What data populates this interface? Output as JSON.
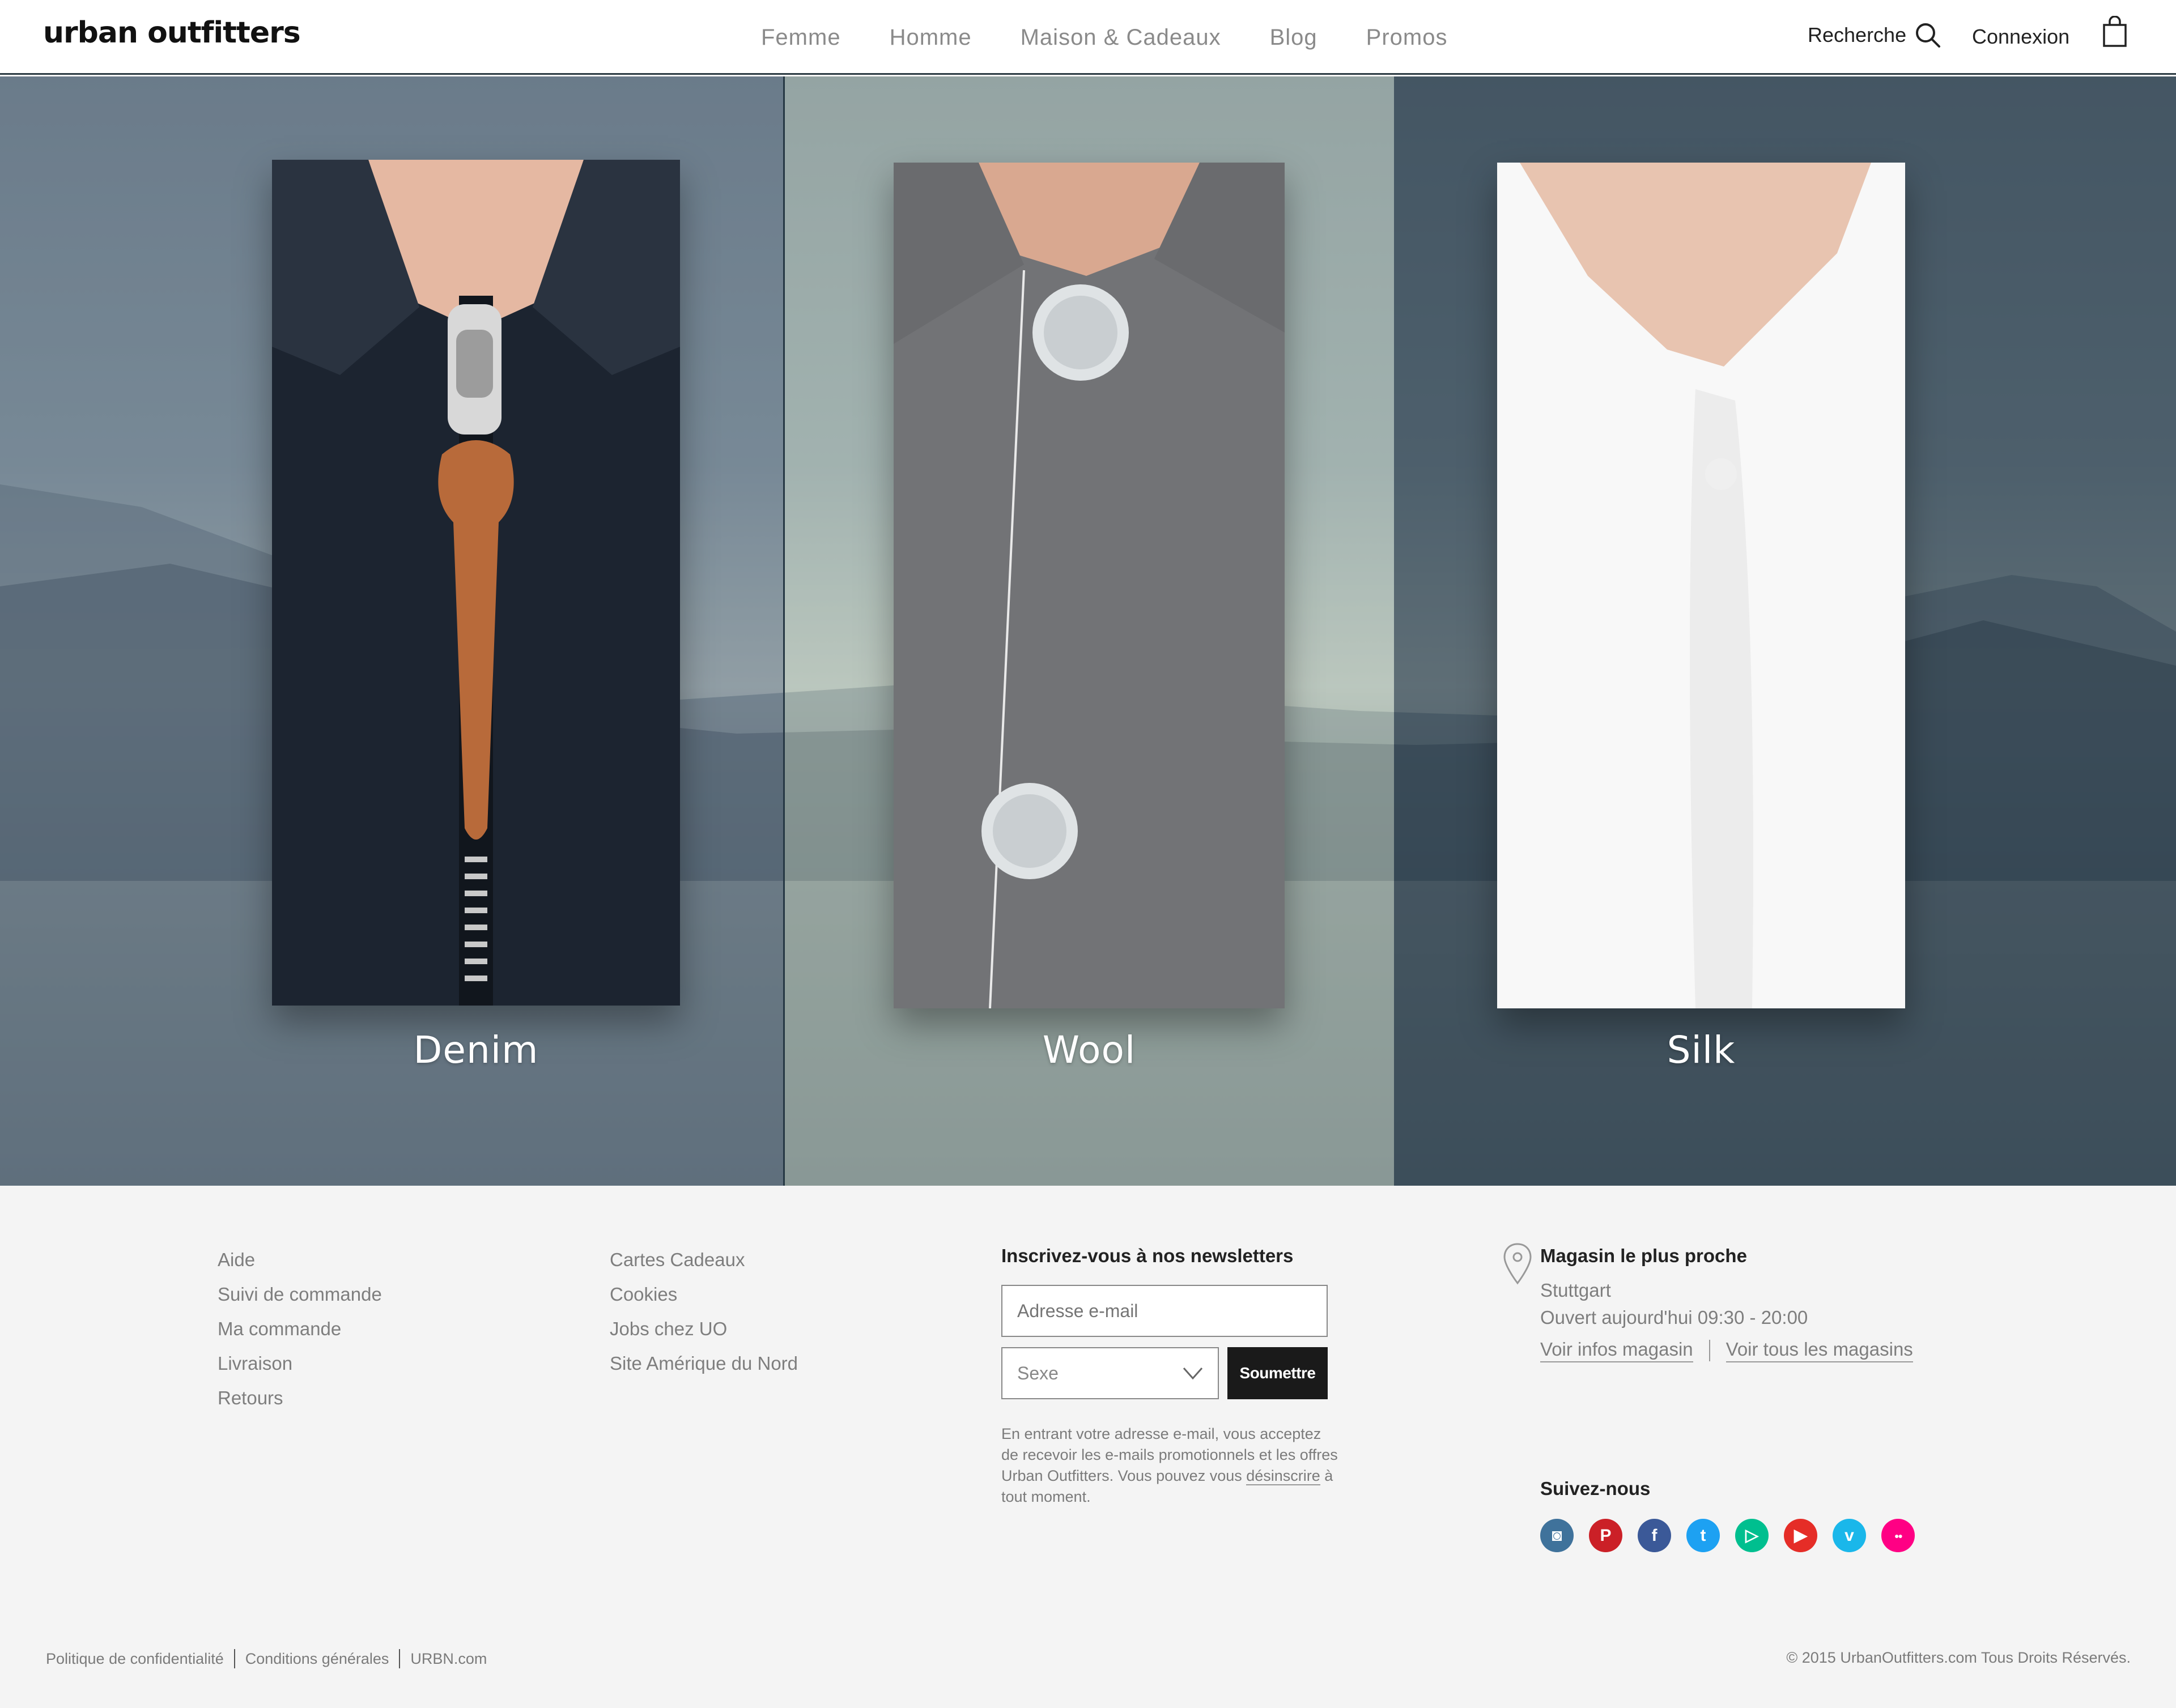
{
  "header": {
    "logo": "urban outfitters",
    "nav": [
      "Femme",
      "Homme",
      "Maison & Cadeaux",
      "Blog",
      "Promos"
    ],
    "search_label": "Recherche",
    "login_label": "Connexion"
  },
  "hero": {
    "items": [
      {
        "label": "Denim"
      },
      {
        "label": "Wool"
      },
      {
        "label": "Silk"
      }
    ]
  },
  "footer": {
    "col1": [
      "Aide",
      "Suivi de commande",
      "Ma commande",
      "Livraison",
      "Retours"
    ],
    "col2": [
      "Cartes Cadeaux",
      "Cookies",
      "Jobs chez UO",
      "Site Amérique du Nord"
    ],
    "newsletter": {
      "title": "Inscrivez-vous à nos newsletters",
      "email_placeholder": "Adresse e-mail",
      "gender_select": "Sexe",
      "submit_label": "Soumettre",
      "legal_before": "En entrant votre adresse e-mail, vous acceptez de recevoir les e-mails promotionnels et les offres Urban Outfitters. Vous pouvez vous ",
      "legal_link": "désinscrire",
      "legal_after": " à tout moment."
    },
    "store": {
      "title": "Magasin le plus proche",
      "city": "Stuttgart",
      "hours": "Ouvert aujourd'hui 09:30 - 20:00",
      "link_info": "Voir infos magasin",
      "link_all": "Voir tous les magasins"
    },
    "follow": {
      "title": "Suivez-nous",
      "icons": [
        {
          "name": "instagram-icon",
          "color": "#3f729b",
          "glyph": "◙"
        },
        {
          "name": "pinterest-icon",
          "color": "#cb2027",
          "glyph": "P"
        },
        {
          "name": "facebook-icon",
          "color": "#3b5998",
          "glyph": "f"
        },
        {
          "name": "twitter-icon",
          "color": "#1da1f2",
          "glyph": "t"
        },
        {
          "name": "vine-icon",
          "color": "#00bf8f",
          "glyph": "▷"
        },
        {
          "name": "youtube-icon",
          "color": "#e52d27",
          "glyph": "▶"
        },
        {
          "name": "vimeo-icon",
          "color": "#1ab7ea",
          "glyph": "v"
        },
        {
          "name": "flickr-icon",
          "color": "#ff0084",
          "glyph": "●●"
        }
      ]
    },
    "bottom_links": [
      "Politique de confidentialité",
      "Conditions générales",
      "URBN.com"
    ],
    "copyright": "© 2015 UrbanOutfitters.com Tous Droits Réservés."
  }
}
